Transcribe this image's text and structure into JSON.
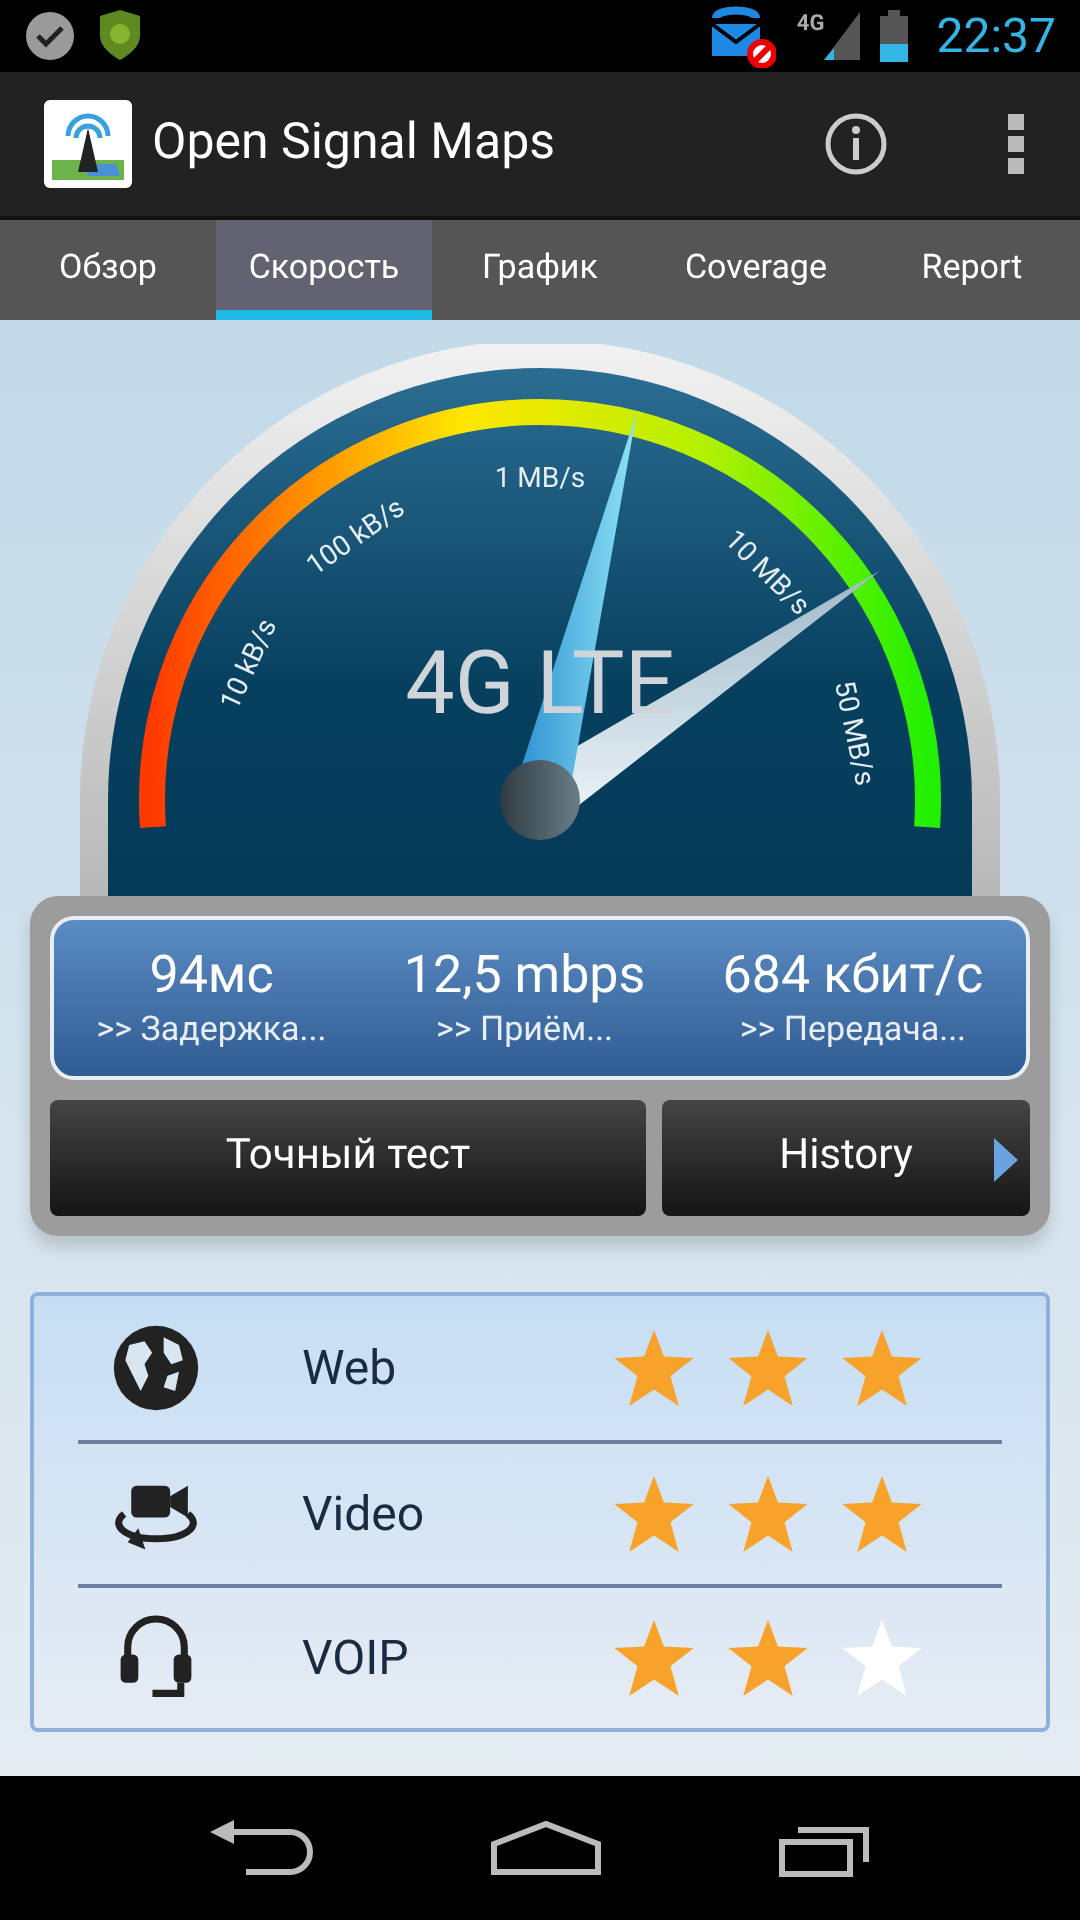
{
  "status_bar": {
    "network": "4G",
    "time": "22:37"
  },
  "app_bar": {
    "title": "Open Signal Maps"
  },
  "tabs": [
    {
      "label": "Обзор",
      "selected": false
    },
    {
      "label": "Скорость",
      "selected": true
    },
    {
      "label": "График",
      "selected": false
    },
    {
      "label": "Coverage",
      "selected": false
    },
    {
      "label": "Report",
      "selected": false
    }
  ],
  "gauge": {
    "network_type": "4G LTE",
    "scale_labels": [
      "10 kB/s",
      "100 kB/s",
      "1 MB/s",
      "10 MB/s",
      "50 MB/s"
    ]
  },
  "results": [
    {
      "value": "94мс",
      "label": ">> Задержка..."
    },
    {
      "value": "12,5 mbps",
      "label": ">> Приём..."
    },
    {
      "value": "684 кбит/с",
      "label": ">> Передача..."
    }
  ],
  "buttons": [
    {
      "label": "Точный тест"
    },
    {
      "label": "History"
    }
  ],
  "ratings": [
    {
      "kind": "web",
      "label": "Web",
      "stars": 3
    },
    {
      "kind": "video",
      "label": "Video",
      "stars": 3
    },
    {
      "kind": "voip",
      "label": "VOIP",
      "stars": 2
    }
  ]
}
